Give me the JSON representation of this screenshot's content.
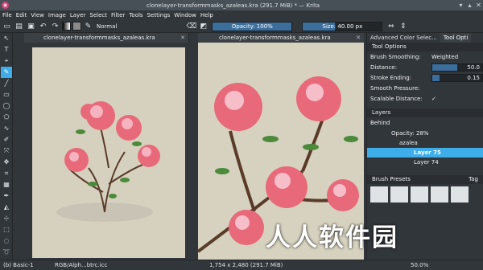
{
  "window": {
    "title": "clonelayer-transformmasks_azaleas.kra (291.7 MiB) * — Krita"
  },
  "menu": [
    "File",
    "Edit",
    "View",
    "Image",
    "Layer",
    "Select",
    "Filter",
    "Tools",
    "Settings",
    "Window",
    "Help"
  ],
  "toolbar": {
    "blend_mode": "Normal",
    "opacity": "Opacity: 100%",
    "opacity_value": 1.0,
    "size": "Size: 40.00 px",
    "size_value": 0.4
  },
  "canvas_left": {
    "tab": "clonelayer-transformmasks_azaleas.kra"
  },
  "canvas_right": {
    "tab": "clonelayer-transformmasks_azaleas.kra"
  },
  "dock": {
    "tabs": [
      "Advanced Color Selec...",
      "Tool Opti"
    ],
    "tool_options": {
      "header": "Tool Options",
      "rows": [
        {
          "label": "Brush Smoothing:",
          "value": "Weighted"
        },
        {
          "label": "Distance:",
          "value": "50.0",
          "fill": 0.5
        },
        {
          "label": "Stroke Ending:",
          "value": "0.15",
          "fill": 0.15
        },
        {
          "label": "Smooth Pressure:",
          "value": ""
        },
        {
          "label": "Scalable Distance:",
          "value": "✓"
        }
      ]
    },
    "layers": {
      "header": "Layers",
      "blend": "Behind",
      "opacity": "Opacity:  28%",
      "items": [
        {
          "name": "azalea",
          "selected": false
        },
        {
          "name": "Layer 75",
          "selected": true
        },
        {
          "name": "Layer 74",
          "selected": false
        }
      ]
    },
    "presets": {
      "header": "Brush Presets",
      "tag": "Tag"
    }
  },
  "status": {
    "brush": "(b) Basic-1",
    "color": "RGB/Alph...btrc.icc",
    "size": "1,754 x 2,480 (291.7 MiB)",
    "zoom": "50.0%"
  },
  "watermark": "人人软件园"
}
